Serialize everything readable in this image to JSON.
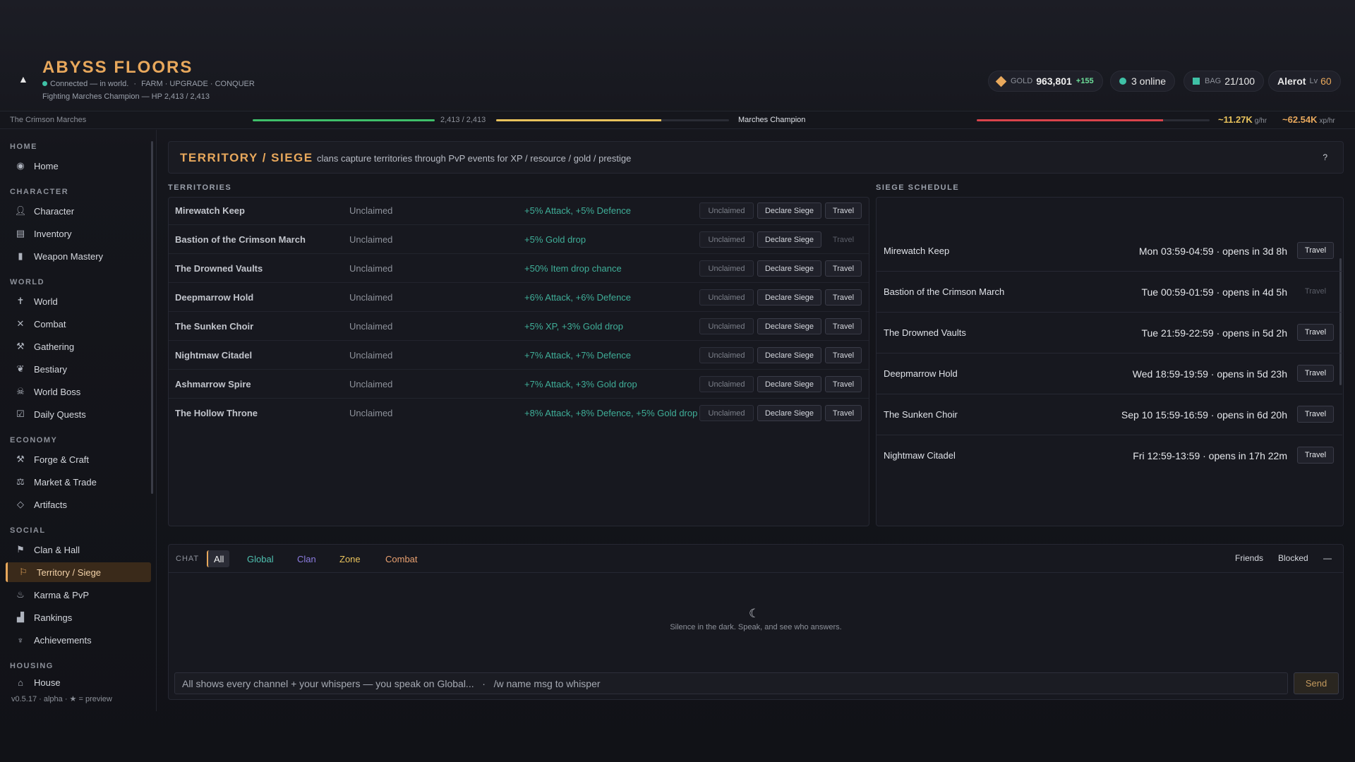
{
  "header": {
    "collapse_icon": "▲",
    "title": "ABYSS FLOORS",
    "status": "Connected — in world.",
    "modes": "FARM · UPGRADE · CONQUER",
    "fighting": "Fighting Marches Champion — HP 2,413 / 2,413",
    "gold_label": "GOLD",
    "gold_value": "963,801",
    "gold_gain": "+155",
    "online": "3 online",
    "bag_label": "BAG",
    "bag_value": "21/100",
    "player_name": "Alerot",
    "level_label": "Lv",
    "level_value": "60",
    "accent": "#e8a85c"
  },
  "strip": {
    "region": "The Crimson Marches",
    "hp_text": "2,413 / 2,413",
    "hp_fraction": 1.0,
    "champion": "Marches Champion",
    "champ_fraction": 0.71,
    "enemy_fraction": 0.8,
    "gold_rate": "~11.27K",
    "gold_rate_unit": "g/hr",
    "xp_rate": "~62.54K",
    "xp_rate_unit": "xp/hr"
  },
  "sidebar": {
    "sections": {
      "home": "HOME",
      "character": "CHARACTER",
      "world": "WORLD",
      "economy": "ECONOMY",
      "social": "SOCIAL",
      "housing": "HOUSING"
    },
    "items": {
      "home": "Home",
      "character": "Character",
      "inventory": "Inventory",
      "weapon_mastery": "Weapon Mastery",
      "world": "World",
      "combat": "Combat",
      "gathering": "Gathering",
      "bestiary": "Bestiary",
      "world_boss": "World Boss",
      "daily_quests": "Daily Quests",
      "forge": "Forge & Craft",
      "market": "Market & Trade",
      "artifacts": "Artifacts",
      "clan": "Clan & Hall",
      "territory": "Territory / Siege",
      "karma": "Karma & PvP",
      "rankings": "Rankings",
      "achievements": "Achievements",
      "house": "House"
    },
    "version": "v0.5.17 · alpha · ★ = preview"
  },
  "page": {
    "title": "TERRITORY / SIEGE",
    "description": "clans capture territories through PvP events for XP / resource / gold / prestige",
    "help": "?"
  },
  "territories": {
    "label": "TERRITORIES",
    "declare_label": "Declare Siege",
    "travel_label": "Travel",
    "rows": [
      {
        "name": "Mirewatch Keep",
        "owner": "Unclaimed",
        "bonus": "+5% Attack, +5% Defence",
        "status": "Unclaimed"
      },
      {
        "name": "Bastion of the Crimson March",
        "owner": "Unclaimed",
        "bonus": "+5% Gold drop",
        "status": "Unclaimed"
      },
      {
        "name": "The Drowned Vaults",
        "owner": "Unclaimed",
        "bonus": "+50% Item drop chance",
        "status": "Unclaimed"
      },
      {
        "name": "Deepmarrow Hold",
        "owner": "Unclaimed",
        "bonus": "+6% Attack, +6% Defence",
        "status": "Unclaimed"
      },
      {
        "name": "The Sunken Choir",
        "owner": "Unclaimed",
        "bonus": "+5% XP, +3% Gold drop",
        "status": "Unclaimed"
      },
      {
        "name": "Nightmaw Citadel",
        "owner": "Unclaimed",
        "bonus": "+7% Attack, +7% Defence",
        "status": "Unclaimed"
      },
      {
        "name": "Ashmarrow Spire",
        "owner": "Unclaimed",
        "bonus": "+7% Attack, +3% Gold drop",
        "status": "Unclaimed"
      },
      {
        "name": "The Hollow Throne",
        "owner": "Unclaimed",
        "bonus": "+8% Attack, +8% Defence, +5% Gold drop",
        "status": "Unclaimed"
      }
    ]
  },
  "schedule": {
    "label": "SIEGE SCHEDULE",
    "travel_label": "Travel",
    "rows": [
      {
        "name": "Mirewatch Keep",
        "time": "Mon 03:59-04:59 · opens in 3d 8h"
      },
      {
        "name": "Bastion of the Crimson March",
        "time": "Tue 00:59-01:59 · opens in 4d 5h"
      },
      {
        "name": "The Drowned Vaults",
        "time": "Tue 21:59-22:59 · opens in 5d 2h"
      },
      {
        "name": "Deepmarrow Hold",
        "time": "Wed 18:59-19:59 · opens in 5d 23h"
      },
      {
        "name": "The Sunken Choir",
        "time": "Sep 10 15:59-16:59 · opens in 6d 20h"
      },
      {
        "name": "Nightmaw Citadel",
        "time": "Fri 12:59-13:59 · opens in 17h 22m"
      }
    ]
  },
  "chat": {
    "label": "CHAT",
    "tabs": {
      "all": "All",
      "global": "Global",
      "clan": "Clan",
      "zone": "Zone",
      "combat": "Combat"
    },
    "friends": "Friends",
    "blocked": "Blocked",
    "minimize": "—",
    "empty_icon": "☾",
    "empty_text": "Silence in the dark. Speak, and see who answers.",
    "placeholder": "All shows every channel + your whispers — you speak on Global...   ·   /w name msg to whisper",
    "send": "Send"
  }
}
